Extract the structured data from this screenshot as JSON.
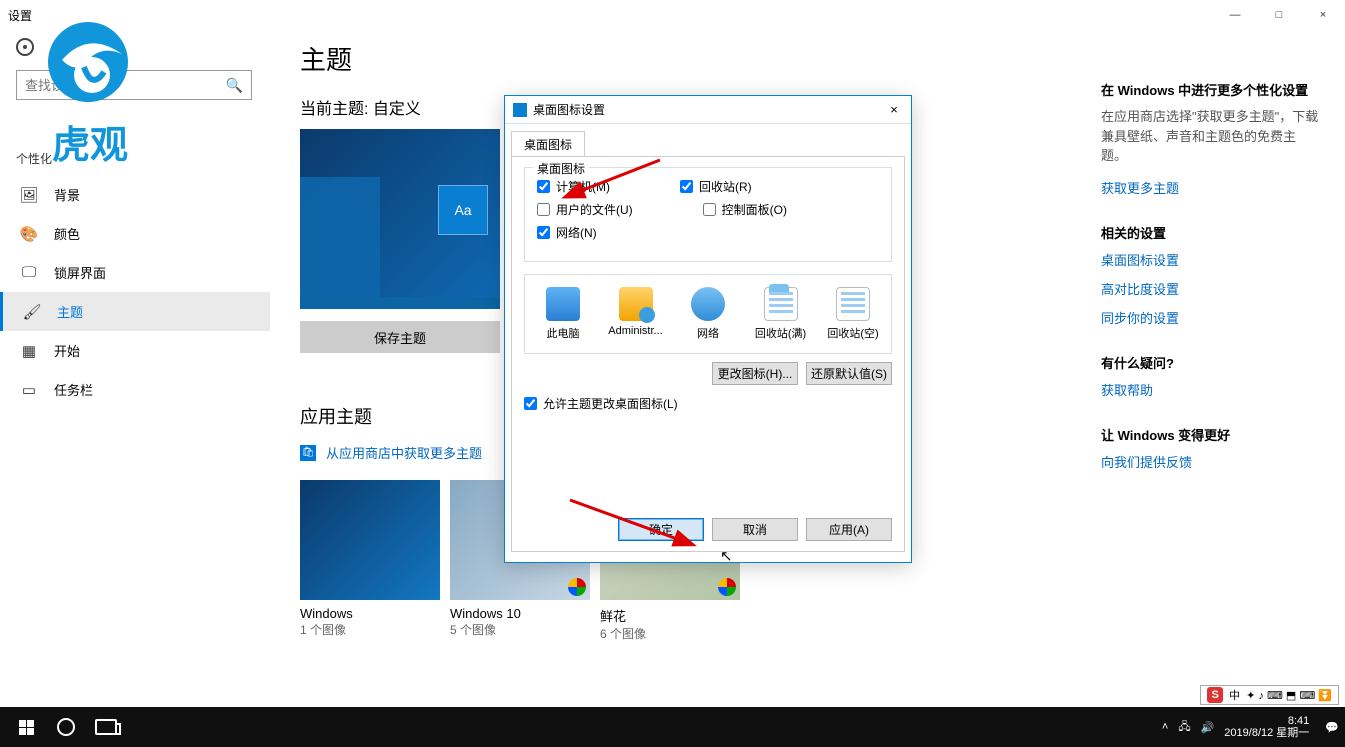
{
  "window": {
    "title": "设置",
    "min": "—",
    "max": "□",
    "close": "×"
  },
  "search": {
    "placeholder": "查找设置"
  },
  "sidebar": {
    "category": "个性化",
    "items": [
      {
        "label": "背景"
      },
      {
        "label": "颜色"
      },
      {
        "label": "锁屏界面"
      },
      {
        "label": "主题"
      },
      {
        "label": "开始"
      },
      {
        "label": "任务栏"
      }
    ]
  },
  "main": {
    "heading": "主题",
    "current_prefix": "当前主题: ",
    "current_value": "自定义",
    "preview_sample": "Aa",
    "save_btn": "保存主题",
    "apply_heading": "应用主题",
    "store_link": "从应用商店中获取更多主题",
    "themes": [
      {
        "name": "Windows",
        "count": "1 个图像",
        "kind": "default"
      },
      {
        "name": "Windows 10",
        "count": "5 个图像",
        "kind": "win10"
      },
      {
        "name": "鲜花",
        "count": "6 个图像",
        "kind": "flowers"
      }
    ]
  },
  "right": {
    "more_heading": "在 Windows 中进行更多个性化设置",
    "more_text": "在应用商店选择\"获取更多主题\"，下载兼具壁纸、声音和主题色的免费主题。",
    "more_link": "获取更多主题",
    "related_heading": "相关的设置",
    "related_links": [
      "桌面图标设置",
      "高对比度设置",
      "同步你的设置"
    ],
    "question_heading": "有什么疑问?",
    "help_link": "获取帮助",
    "better_heading": "让 Windows 变得更好",
    "feedback_link": "向我们提供反馈"
  },
  "dialog": {
    "title": "桌面图标设置",
    "tab": "桌面图标",
    "group_label": "桌面图标",
    "checks": {
      "computer": "计算机(M)",
      "computer_checked": true,
      "recycle": "回收站(R)",
      "recycle_checked": true,
      "user": "用户的文件(U)",
      "user_checked": false,
      "ctrl": "控制面板(O)",
      "ctrl_checked": false,
      "net": "网络(N)",
      "net_checked": true
    },
    "icons": [
      "此电脑",
      "Administr...",
      "网络",
      "回收站(满)",
      "回收站(空)"
    ],
    "change_btn": "更改图标(H)...",
    "restore_btn": "还原默认值(S)",
    "allow_label": "允许主题更改桌面图标(L)",
    "allow_checked": true,
    "ok": "确定",
    "cancel": "取消",
    "apply": "应用(A)"
  },
  "ime": {
    "badge": "S",
    "lang": "中",
    "icons": "✦ ♪ ⌨ ⬒ ⌨ ⏬"
  },
  "taskbar": {
    "time": "8:41",
    "date": "2019/8/12 星期一"
  },
  "logo_text": "虎观"
}
